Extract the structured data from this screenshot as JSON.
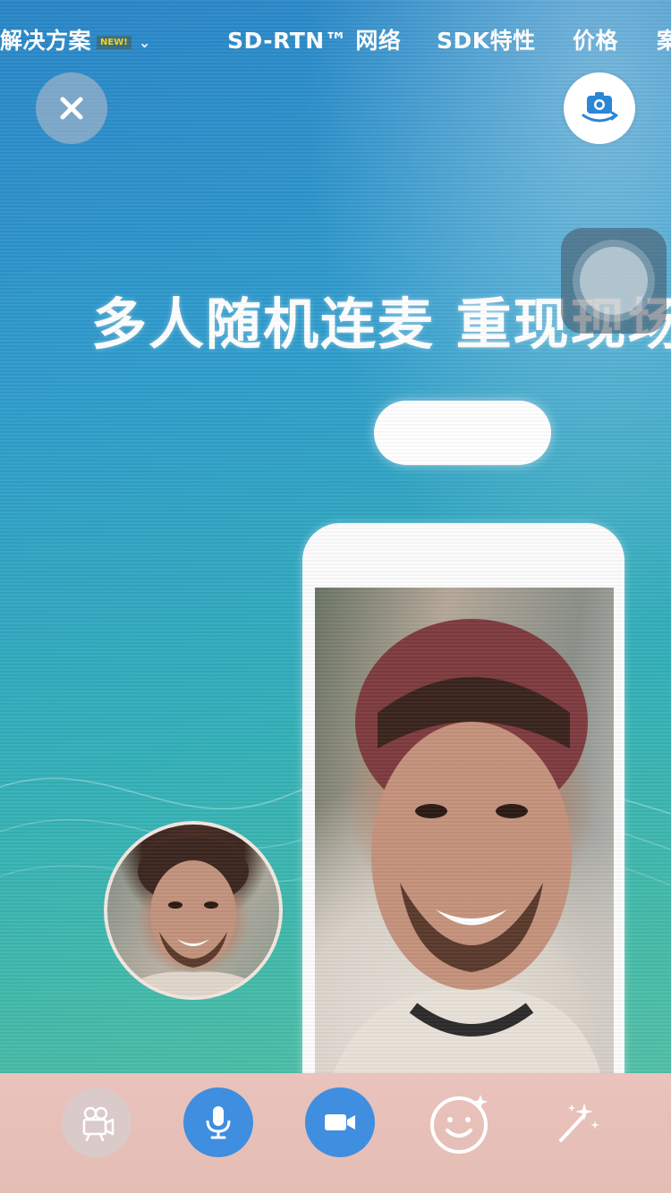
{
  "site_nav": {
    "items": [
      "解决方案",
      "SD-RTN™ 网络",
      "SDK特性",
      "价格",
      "案"
    ],
    "new_badge": "NEW!",
    "caret": "⌄"
  },
  "hero": {
    "headline": "多人随机连麦 重现现场"
  },
  "call_controls": {
    "close_icon": "close-icon",
    "switch_camera_icon": "switch-camera-icon",
    "bottom": [
      "video-effects-icon",
      "microphone-icon",
      "video-camera-icon",
      "face-beauty-icon",
      "magic-wand-icon"
    ]
  },
  "colors": {
    "accent_blue": "#3f8ee0",
    "background_top": "#2a86c8",
    "background_bottom": "#5cc4a6",
    "panel": "#e9c3bc"
  }
}
